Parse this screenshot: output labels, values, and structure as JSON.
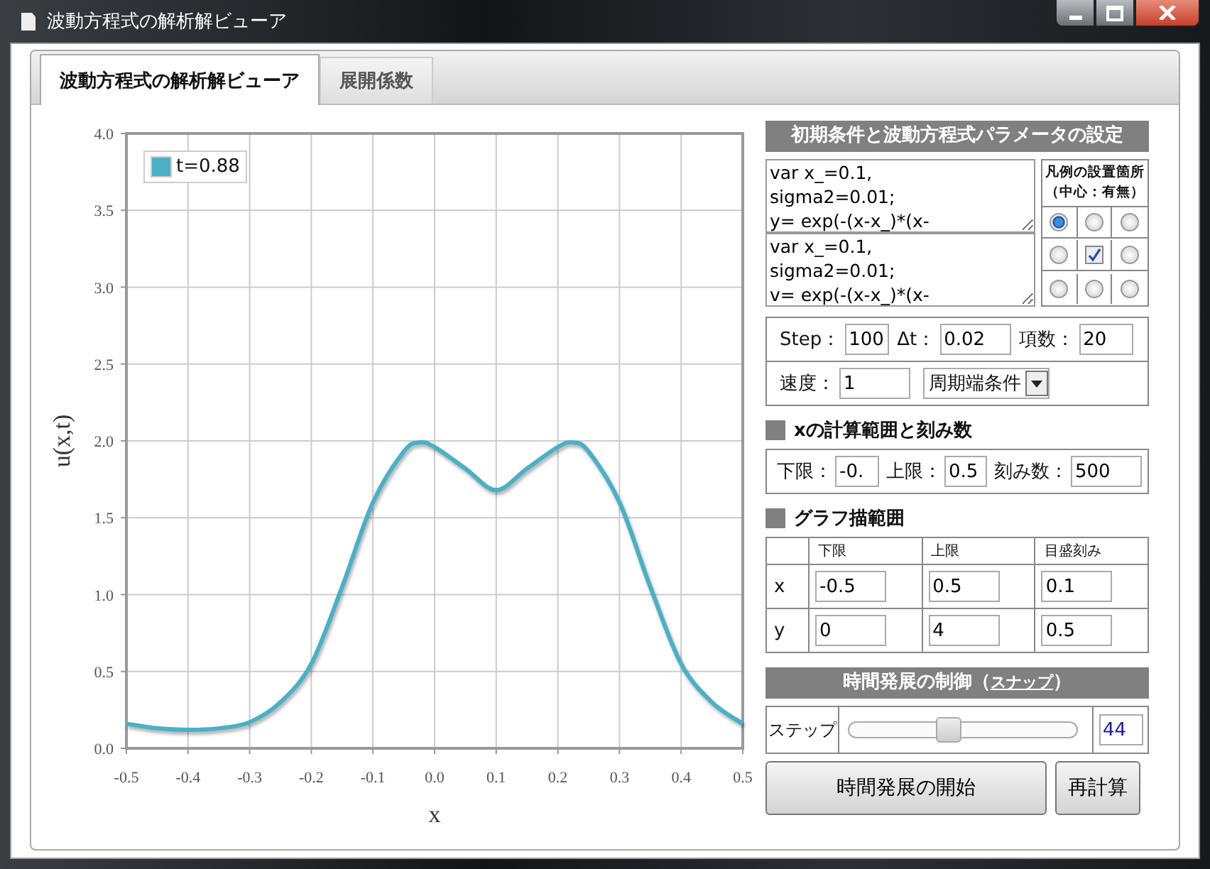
{
  "window": {
    "title": "波動方程式の解析解ビューア"
  },
  "tabs": [
    {
      "label": "波動方程式の解析解ビューア",
      "selected": true
    },
    {
      "label": "展開係数",
      "selected": false
    }
  ],
  "chart": {
    "chart_data": {
      "type": "line",
      "grid": true,
      "xlabel": "x",
      "ylabel": "u(x,t)",
      "x": [
        -0.5,
        -0.45,
        -0.4,
        -0.35,
        -0.3,
        -0.25,
        -0.2,
        -0.15,
        -0.1,
        -0.05,
        -0.025,
        0,
        0.05,
        0.1,
        0.15,
        0.2,
        0.225,
        0.25,
        0.3,
        0.35,
        0.4,
        0.45,
        0.5
      ],
      "series": [
        {
          "name": "t=0.88",
          "color": "#4bb0c6",
          "values": [
            0.16,
            0.13,
            0.12,
            0.13,
            0.17,
            0.3,
            0.55,
            1.05,
            1.6,
            1.93,
            1.99,
            1.96,
            1.82,
            1.68,
            1.82,
            1.96,
            1.99,
            1.93,
            1.6,
            1.05,
            0.55,
            0.3,
            0.16
          ]
        }
      ],
      "xlim": [
        -0.5,
        0.5
      ],
      "ylim": [
        0,
        4
      ],
      "xticks": [
        {
          "value": -0.5,
          "label": "-0.5"
        },
        {
          "value": -0.4,
          "label": "-0.4"
        },
        {
          "value": -0.3,
          "label": "-0.3"
        },
        {
          "value": -0.2,
          "label": "-0.2"
        },
        {
          "value": -0.1,
          "label": "-0.1"
        },
        {
          "value": 0,
          "label": "0.0"
        },
        {
          "value": 0.1,
          "label": "0.1"
        },
        {
          "value": 0.2,
          "label": "0.2"
        },
        {
          "value": 0.3,
          "label": "0.3"
        },
        {
          "value": 0.4,
          "label": "0.4"
        },
        {
          "value": 0.5,
          "label": "0.5"
        }
      ],
      "yticks": [
        {
          "value": 0,
          "label": "0.0"
        },
        {
          "value": 0.5,
          "label": "0.5"
        },
        {
          "value": 1,
          "label": "1.0"
        },
        {
          "value": 1.5,
          "label": "1.5"
        },
        {
          "value": 2,
          "label": "2.0"
        },
        {
          "value": 2.5,
          "label": "2.5"
        },
        {
          "value": 3,
          "label": "3.0"
        },
        {
          "value": 3.5,
          "label": "3.5"
        },
        {
          "value": 4,
          "label": "4.0"
        }
      ]
    }
  },
  "settings": {
    "title": "初期条件と波動方程式パラメータの設定",
    "editors": [
      {
        "value": "var x_=0.1,\nsigma2=0.01;\ny= exp(-(x-x_)*(x-"
      },
      {
        "value": "var x_=0.1,\nsigma2=0.01;\nv= exp(-(x-x_)*(x-"
      }
    ],
    "legend_position": {
      "title": "凡例の設置箇所",
      "subtitle": "（中心：有無）",
      "cells": [
        {
          "kind": "radio",
          "selected": true
        },
        {
          "kind": "radio",
          "selected": false
        },
        {
          "kind": "radio",
          "selected": false
        },
        {
          "kind": "radio",
          "selected": false
        },
        {
          "kind": "checkbox",
          "checked": true
        },
        {
          "kind": "radio",
          "selected": false
        },
        {
          "kind": "radio",
          "selected": false
        },
        {
          "kind": "radio",
          "selected": false
        },
        {
          "kind": "radio",
          "selected": false
        }
      ]
    },
    "params": [
      {
        "label": "Step：",
        "value": "100"
      },
      {
        "label": "Δt：",
        "value": "0.02"
      },
      {
        "label": "項数：",
        "value": "20"
      },
      {
        "label": "速度：",
        "value": "1"
      }
    ],
    "boundary": {
      "value": "周期端条件"
    }
  },
  "x_range": {
    "title": "xの計算範囲と刻み数",
    "fields": [
      {
        "label": "下限：",
        "value": "-0."
      },
      {
        "label": "上限：",
        "value": "0.5"
      },
      {
        "label": "刻み数：",
        "value": "500"
      }
    ]
  },
  "graph_range": {
    "title": "グラフ描範囲",
    "columns": [
      "下限",
      "上限",
      "目盛刻み"
    ],
    "rows": [
      {
        "label": "x",
        "values": [
          "-0.5",
          "0.5",
          "0.1"
        ]
      },
      {
        "label": "y",
        "values": [
          "0",
          "4",
          "0.5"
        ]
      }
    ]
  },
  "time_control": {
    "title_before": "時間発展の制御（",
    "link": "スナップ",
    "title_after": "）",
    "step_label": "ステップ",
    "slider": {
      "level": 0.44
    },
    "step_value": "44",
    "buttons": [
      {
        "label": "時間発展の開始"
      },
      {
        "label": "再計算"
      }
    ]
  }
}
